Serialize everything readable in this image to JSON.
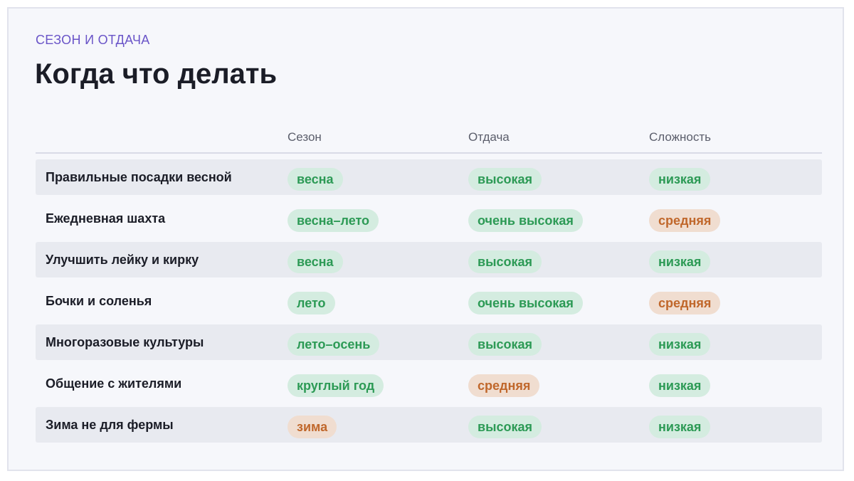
{
  "header": {
    "eyebrow": "СЕЗОН И ОТДАЧА",
    "title": "Когда что делать"
  },
  "columns": [
    "Сезон",
    "Отдача",
    "Сложность"
  ],
  "colors": {
    "accent": "#6a55c8",
    "good_bg": "#d4ece0",
    "good_text": "#2c9a55",
    "mid_bg": "#f0ddd0",
    "mid_text": "#c0672b"
  },
  "rows": [
    {
      "name": "Правильные посадки весной",
      "season": "весна",
      "season_tone": "good",
      "yield": "высокая",
      "yield_tone": "good",
      "difficulty": "низкая",
      "difficulty_tone": "good"
    },
    {
      "name": "Ежедневная шахта",
      "season": "весна–лето",
      "season_tone": "good",
      "yield": "очень высокая",
      "yield_tone": "good",
      "difficulty": "средняя",
      "difficulty_tone": "mid"
    },
    {
      "name": "Улучшить лейку и кирку",
      "season": "весна",
      "season_tone": "good",
      "yield": "высокая",
      "yield_tone": "good",
      "difficulty": "низкая",
      "difficulty_tone": "good"
    },
    {
      "name": "Бочки и соленья",
      "season": "лето",
      "season_tone": "good",
      "yield": "очень высокая",
      "yield_tone": "good",
      "difficulty": "средняя",
      "difficulty_tone": "mid"
    },
    {
      "name": "Многоразовые культуры",
      "season": "лето–осень",
      "season_tone": "good",
      "yield": "высокая",
      "yield_tone": "good",
      "difficulty": "низкая",
      "difficulty_tone": "good"
    },
    {
      "name": "Общение с жителями",
      "season": "круглый год",
      "season_tone": "good",
      "yield": "средняя",
      "yield_tone": "mid",
      "difficulty": "низкая",
      "difficulty_tone": "good"
    },
    {
      "name": "Зима не для фермы",
      "season": "зима",
      "season_tone": "mid",
      "yield": "высокая",
      "yield_tone": "good",
      "difficulty": "низкая",
      "difficulty_tone": "good"
    }
  ]
}
